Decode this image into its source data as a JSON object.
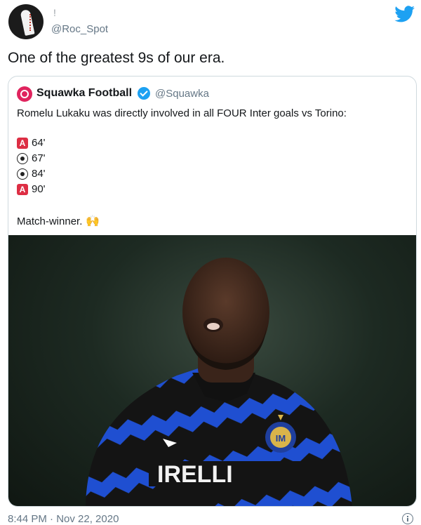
{
  "tweet": {
    "author_name": "!",
    "handle": "@Roc_Spot",
    "text": "One of the greatest 9s of our era.",
    "timestamp": "8:44 PM · Nov 22, 2020"
  },
  "quoted": {
    "name": "Squawka Football",
    "handle": "@Squawka",
    "text": "Romelu Lukaku was directly involved in all FOUR Inter goals vs Torino:",
    "events": [
      {
        "type": "assist",
        "icon": "assist-icon",
        "icon_text": "A",
        "minute": "64'"
      },
      {
        "type": "goal",
        "icon": "soccer-ball-icon",
        "icon_text": "",
        "minute": "67'"
      },
      {
        "type": "goal",
        "icon": "soccer-ball-icon",
        "icon_text": "",
        "minute": "84'"
      },
      {
        "type": "assist",
        "icon": "assist-icon",
        "icon_text": "A",
        "minute": "90'"
      }
    ],
    "closing_text": "Match-winner.",
    "closing_emoji": "🙌",
    "photo_kit_text": "IRELLI"
  },
  "colors": {
    "twitter_blue": "#1da1f2",
    "squawka_red": "#e0245e",
    "inter_blue": "#1f4fd1",
    "text": "#14171a",
    "secondary": "#657786"
  }
}
